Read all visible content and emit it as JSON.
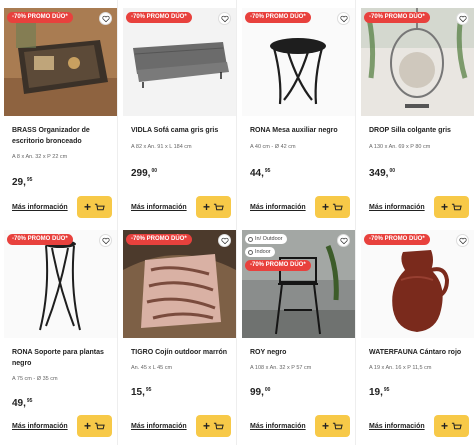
{
  "promo_label": "-70% PROMO DÚO*",
  "more_label": "Más información",
  "add_label": "+",
  "products": [
    {
      "id": "brass",
      "name": "BRASS Organizador de escritorio bronceado",
      "dims": "A 8 x An. 32 x P 22 cm",
      "price": "29,",
      "cents": "95",
      "promo": true
    },
    {
      "id": "vidla",
      "name": "VIDLA Sofá cama gris gris",
      "dims": "A 82 x An. 91 x L 184 cm",
      "price": "299,",
      "cents": "00",
      "promo": true
    },
    {
      "id": "rona-mesa",
      "name": "RONA Mesa auxiliar negro",
      "dims": "A 40 cm - Ø 42 cm",
      "price": "44,",
      "cents": "95",
      "promo": true
    },
    {
      "id": "drop",
      "name": "DROP Silla colgante gris",
      "dims": "A 130 x An. 69 x P 80 cm",
      "price": "349,",
      "cents": "00",
      "promo": true
    },
    {
      "id": "rona-soporte",
      "name": "RONA Soporte para plantas negro",
      "dims": "A 75 cm - Ø 35 cm",
      "price": "49,",
      "cents": "95",
      "promo": true
    },
    {
      "id": "tigro",
      "name": "TIGRO Cojín outdoor marrón",
      "dims": "An. 45 x L 45 cm",
      "price": "15,",
      "cents": "95",
      "promo": true
    },
    {
      "id": "roy",
      "name": "ROY negro",
      "dims": "A 108 x An. 32 x P 57 cm",
      "price": "99,",
      "cents": "00",
      "promo": true,
      "chips": [
        "In/ Outdoor",
        "Indoor"
      ]
    },
    {
      "id": "waterfauna",
      "name": "WATERFAUNA Cántaro rojo",
      "dims": "A 19 x An. 16 x P 11,5 cm",
      "price": "19,",
      "cents": "95",
      "promo": true
    }
  ],
  "colors": {
    "promo": "#e8413d",
    "button": "#f7c948"
  }
}
